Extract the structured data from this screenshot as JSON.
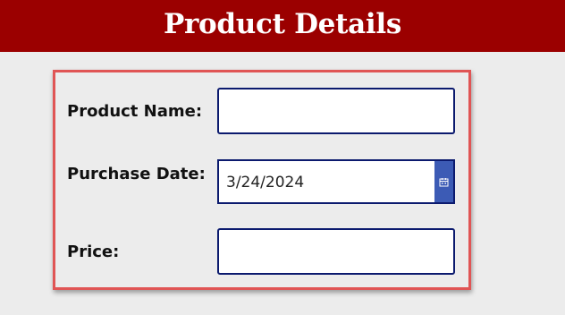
{
  "header": {
    "title": "Product Details",
    "background_color": "#9b0000"
  },
  "form": {
    "border_color": "#e05555",
    "fields": {
      "product_name": {
        "label": "Product Name:",
        "value": ""
      },
      "purchase_date": {
        "label": "Purchase Date:",
        "value": "3/24/2024",
        "button_icon": "calendar-icon",
        "button_color": "#3c5bb5"
      },
      "price": {
        "label": "Price:",
        "value": ""
      }
    }
  }
}
